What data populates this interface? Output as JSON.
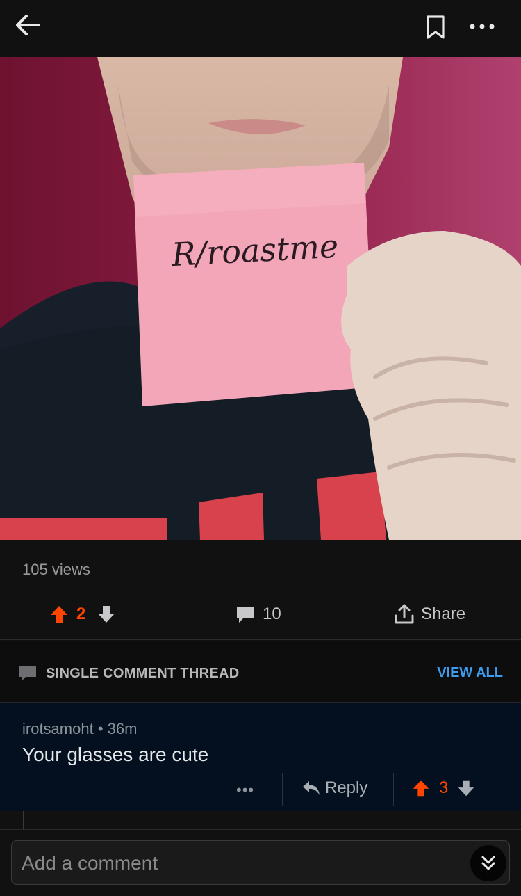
{
  "topbar": {
    "back_icon": "arrow-left-icon",
    "bookmark_icon": "bookmark-icon",
    "more_icon": "more-horizontal-icon"
  },
  "post": {
    "image": {
      "sign_text": "R/roastme",
      "colors": {
        "wall": "#8a1d46",
        "paper": "#f2a6b8",
        "shirt": "#17202a",
        "stripe": "#d8424c",
        "skin": "#e6d4c8"
      }
    },
    "views": "105 views",
    "score": "2",
    "comments_count": "10",
    "share_label": "Share"
  },
  "thread": {
    "title": "SINGLE COMMENT THREAD",
    "view_all": "VIEW ALL"
  },
  "comment": {
    "author": "irotsamoht",
    "separator": "•",
    "age": "36m",
    "body": "Your glasses are cute",
    "more_label": "•••",
    "reply_label": "Reply",
    "score": "3"
  },
  "composer": {
    "placeholder": "Add a comment",
    "collapse_icon": "double-chevron-down-icon"
  },
  "colors": {
    "accent_upvote": "#ff4500",
    "link_blue": "#3d9cf0",
    "background": "#111112",
    "comment_bg": "#041020"
  }
}
